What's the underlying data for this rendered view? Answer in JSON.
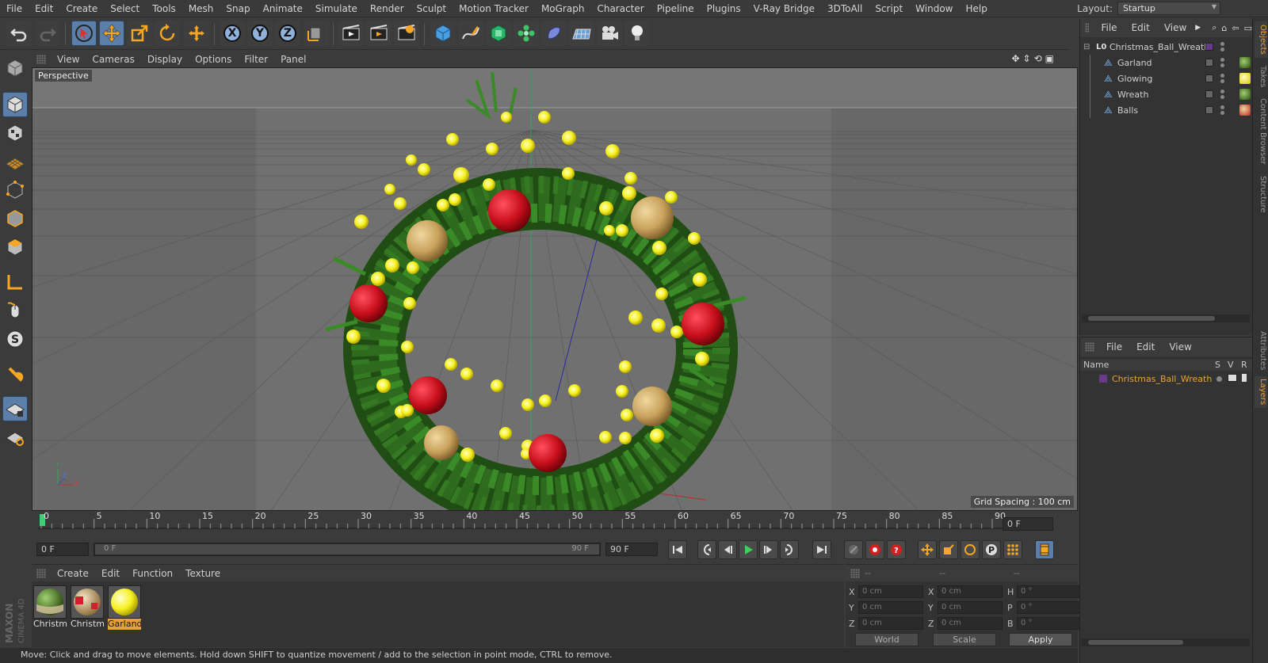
{
  "menubar": {
    "items": [
      "File",
      "Edit",
      "Create",
      "Select",
      "Tools",
      "Mesh",
      "Snap",
      "Animate",
      "Simulate",
      "Render",
      "Sculpt",
      "Motion Tracker",
      "MoGraph",
      "Character",
      "Pipeline",
      "Plugins",
      "V-Ray Bridge",
      "3DToAll",
      "Script",
      "Window",
      "Help"
    ],
    "layout_label": "Layout:",
    "layout_value": "Startup"
  },
  "toolbar": {
    "icons": [
      "undo-icon",
      "redo-icon",
      "live-select-icon",
      "move-icon",
      "scale-icon",
      "rotate-icon",
      "recent-tool-icon",
      "x-axis-lock",
      "y-axis-lock",
      "z-axis-lock",
      "world-coordinates-icon",
      "render-view-icon",
      "render-picture-viewer-icon",
      "edit-render-settings-icon",
      "cube-primitive-icon",
      "spline-pen-icon",
      "generator-icon",
      "mograph-cloner-icon",
      "deformer-icon",
      "floor-icon",
      "camera-icon",
      "light-icon"
    ],
    "axis": {
      "x": "X",
      "y": "Y",
      "z": "Z"
    }
  },
  "viewport": {
    "menu": [
      "View",
      "Cameras",
      "Display",
      "Options",
      "Filter",
      "Panel"
    ],
    "camera_label": "Perspective",
    "grid_spacing": "Grid Spacing : 100 cm",
    "axis_labels": {
      "y": "Y",
      "z": "Z",
      "x": "X"
    }
  },
  "timeline": {
    "ticks": [
      "0",
      "5",
      "10",
      "15",
      "20",
      "25",
      "30",
      "35",
      "40",
      "45",
      "50",
      "55",
      "60",
      "65",
      "70",
      "75",
      "80",
      "85",
      "90"
    ],
    "current_frame": "0 F",
    "end_frame_field": "0 F"
  },
  "transport": {
    "start_field": "0 F",
    "slider_start": "0 F",
    "slider_end": "90 F",
    "end_field": "90 F"
  },
  "materials": {
    "menu": [
      "Create",
      "Edit",
      "Function",
      "Texture"
    ],
    "items": [
      {
        "name": "Christm",
        "color": "#4f7a2a"
      },
      {
        "name": "Christm",
        "color": "#c8a060"
      },
      {
        "name": "Garland",
        "color": "#f2f020"
      }
    ]
  },
  "coordinates": {
    "header": [
      "--",
      "--",
      "--"
    ],
    "rows": [
      {
        "a": "X",
        "v1": "0 cm",
        "b": "X",
        "v2": "0 cm",
        "c": "H",
        "v3": "0 °"
      },
      {
        "a": "Y",
        "v1": "0 cm",
        "b": "Y",
        "v2": "0 cm",
        "c": "P",
        "v3": "0 °"
      },
      {
        "a": "Z",
        "v1": "0 cm",
        "b": "Z",
        "v2": "0 cm",
        "c": "B",
        "v3": "0 °"
      }
    ],
    "mode": "World",
    "size_mode": "Scale",
    "apply": "Apply"
  },
  "status": "Move: Click and drag to move elements. Hold down SHIFT to quantize movement / add to the selection in point mode, CTRL to remove.",
  "objects": {
    "menu": [
      "File",
      "Edit",
      "View"
    ],
    "root": "Christmas_Ball_Wreath",
    "children": [
      "Garland",
      "Glowing",
      "Wreath",
      "Balls"
    ]
  },
  "layers": {
    "menu": [
      "File",
      "Edit",
      "View"
    ],
    "columns": {
      "name": "Name",
      "s": "S",
      "v": "V",
      "r": "R"
    },
    "items": [
      "Christmas_Ball_Wreath"
    ]
  },
  "side_tabs": [
    "Objects",
    "Takes",
    "Content Browser",
    "Structure",
    "Attributes",
    "Layers"
  ],
  "brand": "MAXON CINEMA 4D",
  "colors": {
    "accent": "#e8a23c",
    "selection_blue": "#5b7fa8",
    "layer_color": "#6a3a8a"
  }
}
